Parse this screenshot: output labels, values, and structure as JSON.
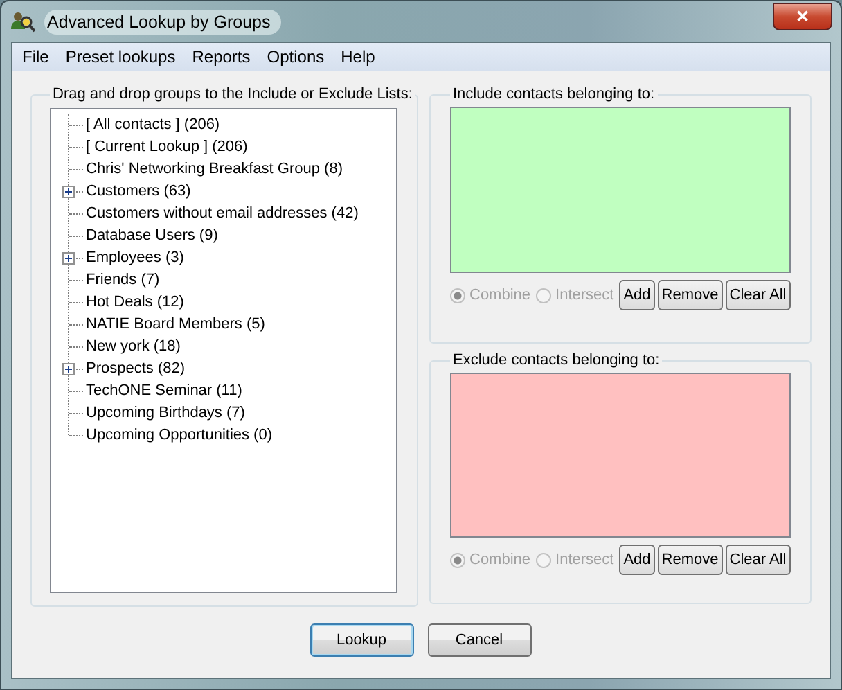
{
  "window": {
    "title": "Advanced Lookup by Groups",
    "close": "✕"
  },
  "menu": [
    "File",
    "Preset lookups",
    "Reports",
    "Options",
    "Help"
  ],
  "groups_panel": {
    "title": "Drag and drop groups to the Include or Exclude Lists:",
    "tree": [
      {
        "label": "[ All contacts ] (206)",
        "expandable": false
      },
      {
        "label": "[ Current Lookup ] (206)",
        "expandable": false
      },
      {
        "label": "Chris' Networking Breakfast Group (8)",
        "expandable": false
      },
      {
        "label": "Customers (63)",
        "expandable": true
      },
      {
        "label": "Customers without email addresses (42)",
        "expandable": false
      },
      {
        "label": "Database Users (9)",
        "expandable": false
      },
      {
        "label": "Employees (3)",
        "expandable": true
      },
      {
        "label": "Friends (7)",
        "expandable": false
      },
      {
        "label": "Hot Deals (12)",
        "expandable": false
      },
      {
        "label": "NATIE Board Members (5)",
        "expandable": false
      },
      {
        "label": "New york (18)",
        "expandable": false
      },
      {
        "label": "Prospects (82)",
        "expandable": true
      },
      {
        "label": "TechONE Seminar (11)",
        "expandable": false
      },
      {
        "label": "Upcoming Birthdays (7)",
        "expandable": false
      },
      {
        "label": "Upcoming Opportunities (0)",
        "expandable": false
      }
    ]
  },
  "lists": [
    {
      "kind": "include",
      "title": "Include contacts belonging to:",
      "color": "#c0ffc0",
      "radios": [
        {
          "label": "Combine",
          "selected": true,
          "disabled": true
        },
        {
          "label": "Intersect",
          "selected": false,
          "disabled": true
        }
      ],
      "buttons": [
        "Add",
        "Remove",
        "Clear All"
      ]
    },
    {
      "kind": "exclude",
      "title": "Exclude contacts belonging to:",
      "color": "#ffc0c0",
      "radios": [
        {
          "label": "Combine",
          "selected": true,
          "disabled": true
        },
        {
          "label": "Intersect",
          "selected": false,
          "disabled": true
        }
      ],
      "buttons": [
        "Add",
        "Remove",
        "Clear All"
      ]
    }
  ],
  "footer": [
    {
      "label": "Lookup",
      "default": true
    },
    {
      "label": "Cancel",
      "default": false
    }
  ]
}
